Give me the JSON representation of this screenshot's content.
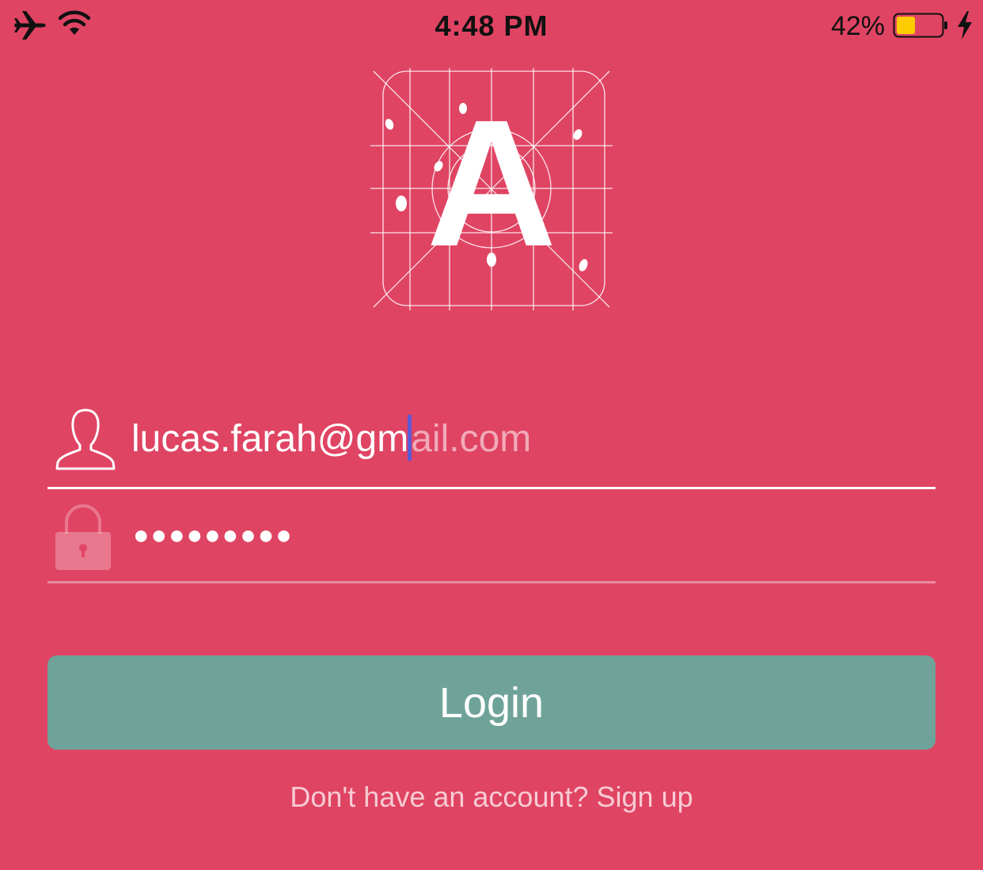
{
  "status_bar": {
    "time": "4:48 PM",
    "battery_percent": "42%",
    "battery_level": 0.42,
    "battery_color": "#ffcc00",
    "icons": [
      "airplane-icon",
      "wifi-icon",
      "battery-icon",
      "charging-bolt-icon"
    ]
  },
  "logo": {
    "letter": "A",
    "icon": "app-logo-grid"
  },
  "login_form": {
    "email": {
      "typed": "lucas.farah@gm",
      "suggestion": "ail.com",
      "icon": "user-icon"
    },
    "password": {
      "masked_value": "●●●●●●●●●",
      "icon": "lock-icon"
    },
    "login_button_label": "Login",
    "signup_text": "Don't have an account? Sign up"
  },
  "colors": {
    "background": "#e04463",
    "button": "#6fa39a",
    "caret": "#5b5bd6"
  }
}
